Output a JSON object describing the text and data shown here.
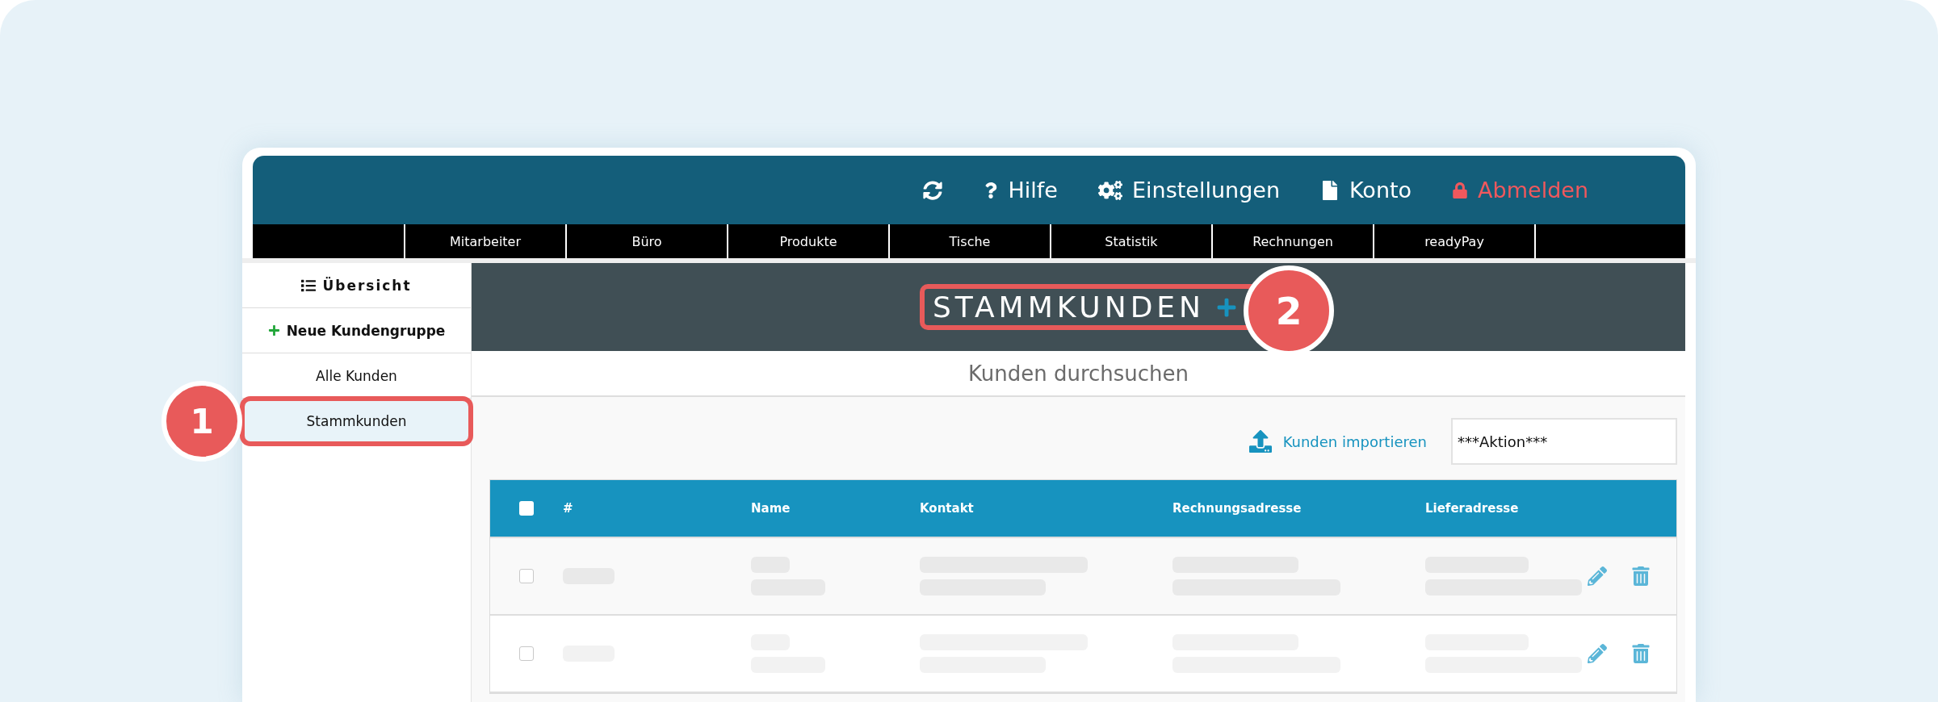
{
  "top_bar": {
    "items": [
      {
        "kind": "refresh"
      },
      {
        "kind": "help",
        "label": "Hilfe"
      },
      {
        "kind": "settings",
        "label": "Einstellungen"
      },
      {
        "kind": "account",
        "label": "Konto"
      },
      {
        "kind": "logout",
        "label": "Abmelden"
      }
    ]
  },
  "nav": [
    "Mitarbeiter",
    "Büro",
    "Produkte",
    "Tische",
    "Statistik",
    "Rechnungen",
    "readyPay"
  ],
  "sidebar": {
    "items": [
      {
        "kind": "overview",
        "label": "Übersicht",
        "selected": false
      },
      {
        "kind": "add",
        "label": "Neue Kundengruppe",
        "selected": false
      },
      {
        "kind": "group",
        "label": "Alle Kunden",
        "selected": false
      },
      {
        "kind": "group",
        "label": "Stammkunden",
        "selected": true,
        "callout": "1"
      }
    ]
  },
  "group_title": {
    "text": "STAMMKUNDEN",
    "callout": "2"
  },
  "search": {
    "label": "Kunden durchsuchen"
  },
  "toolbar": {
    "import_link": "Kunden importieren",
    "action_select": {
      "value": "***Aktion***"
    }
  },
  "table": {
    "select_all": {
      "checked": false
    },
    "columns": [
      "#",
      "Name",
      "Kontakt",
      "Rechnungsadresse",
      "Lieferadresse"
    ],
    "rows": [
      {
        "checked": false
      },
      {
        "checked": false
      }
    ]
  }
}
